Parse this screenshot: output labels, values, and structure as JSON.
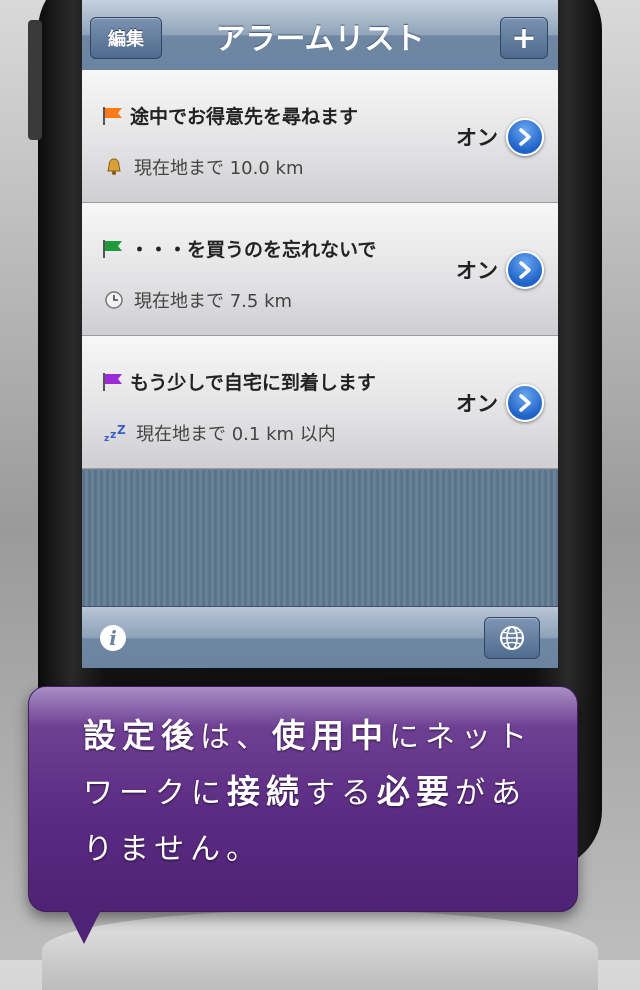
{
  "navbar": {
    "title": "アラームリスト",
    "edit_label": "編集",
    "add_label": "+"
  },
  "alarms": [
    {
      "title": "途中でお得意先を尋ねます",
      "flag_color": "#ff7a1a",
      "subtitle_icon": "bell-icon",
      "subtitle": "現在地まで 10.0 km",
      "status": "オン"
    },
    {
      "title": "・・・を買うのを忘れないで",
      "flag_color": "#1f9a3a",
      "subtitle_icon": "clock-icon",
      "subtitle": "現在地まで 7.5 km",
      "status": "オン"
    },
    {
      "title": "もう少しで自宅に到着します",
      "flag_color": "#9a2bd6",
      "subtitle_icon": "sleep-zzz-icon",
      "subtitle": "現在地まで 0.1 km 以内",
      "status": "オン"
    }
  ],
  "toolbar": {
    "info_icon": "info-icon",
    "globe_icon": "globe-icon"
  },
  "callout": {
    "parts": [
      "設定後",
      "は、",
      "使用中",
      "にネット",
      "ワーク",
      "に",
      "接続",
      "する",
      "必要",
      "があ",
      "りません。"
    ]
  },
  "colors": {
    "accent_blue": "#1f63c8",
    "callout_purple": "#5a2a82"
  }
}
